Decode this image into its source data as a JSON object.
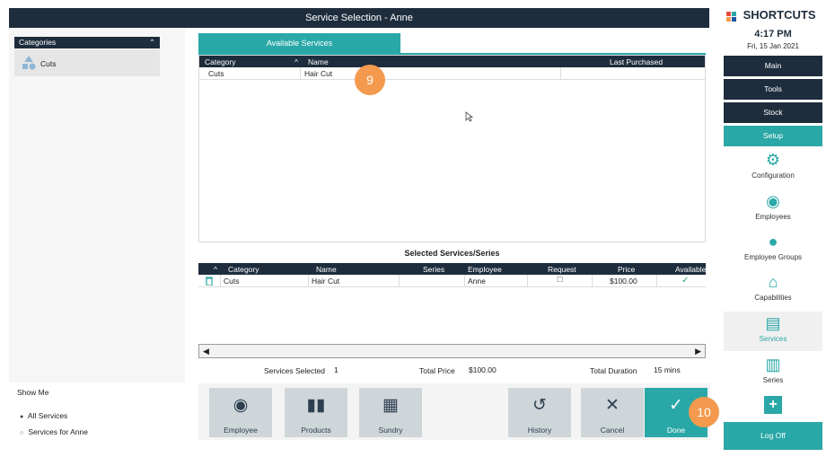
{
  "window": {
    "title": "Service Selection - Anne"
  },
  "categories": {
    "header": "Categories",
    "items": [
      {
        "label": "Cuts"
      }
    ]
  },
  "show_me": {
    "label": "Show Me",
    "options": [
      {
        "label": "All Services",
        "selected": true
      },
      {
        "label": "Services for Anne",
        "selected": false
      }
    ]
  },
  "available": {
    "tab_label": "Available Services",
    "columns": [
      "Category",
      "Name",
      "Last Purchased"
    ],
    "rows": [
      {
        "category": "Cuts",
        "name": "Hair Cut",
        "last_purchased": ""
      }
    ]
  },
  "selected": {
    "title": "Selected Services/Series",
    "columns": [
      "Category",
      "Name",
      "Series",
      "Employee",
      "Request",
      "Price",
      "Available"
    ],
    "rows": [
      {
        "category": "Cuts",
        "name": "Hair Cut",
        "series": "",
        "employee": "Anne",
        "request": false,
        "price": "$100.00",
        "available": true
      }
    ]
  },
  "summary": {
    "services_selected_label": "Services Selected",
    "services_selected_value": "1",
    "total_price_label": "Total Price",
    "total_price_value": "$100.00",
    "total_duration_label": "Total Duration",
    "total_duration_value": "15 mins"
  },
  "buttons": {
    "employee": "Employee",
    "products": "Products",
    "sundry": "Sundry",
    "history": "History",
    "cancel": "Cancel",
    "done": "Done"
  },
  "sidebar": {
    "brand": "SHORTCUTS",
    "time": "4:17 PM",
    "date": "Fri, 15 Jan 2021",
    "nav": [
      "Main",
      "Tools",
      "Stock",
      "Setup"
    ],
    "items": [
      {
        "label": "Configuration",
        "icon": "gear-icon"
      },
      {
        "label": "Employees",
        "icon": "person-icon"
      },
      {
        "label": "Employee Groups",
        "icon": "group-icon"
      },
      {
        "label": "Capabilities",
        "icon": "graduation-cap-icon"
      },
      {
        "label": "Services",
        "icon": "book-icon"
      },
      {
        "label": "Series",
        "icon": "stack-icon"
      }
    ],
    "logoff": "Log Off"
  },
  "badges": [
    "9",
    "10"
  ],
  "colors": {
    "navy": "#1e2d3d",
    "teal": "#2aa7a7",
    "badge": "#f39a4e"
  }
}
